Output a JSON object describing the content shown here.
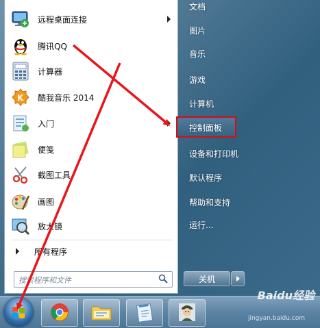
{
  "left_programs": [
    {
      "label": "远程桌面连接",
      "icon": "remote-desktop-icon",
      "submenu": true
    },
    {
      "label": "腾讯QQ",
      "icon": "qq-penguin-icon",
      "submenu": false
    },
    {
      "label": "计算器",
      "icon": "calculator-icon",
      "submenu": false
    },
    {
      "label": "酷我音乐 2014",
      "icon": "kuwo-music-icon",
      "submenu": false
    },
    {
      "label": "入门",
      "icon": "getting-started-icon",
      "submenu": true
    },
    {
      "label": "便笺",
      "icon": "sticky-notes-icon",
      "submenu": false
    },
    {
      "label": "截图工具",
      "icon": "snipping-tool-icon",
      "submenu": false
    },
    {
      "label": "画图",
      "icon": "paint-icon",
      "submenu": false
    },
    {
      "label": "放大镜",
      "icon": "magnifier-icon",
      "submenu": false
    }
  ],
  "all_programs": "所有程序",
  "search": {
    "placeholder": "搜索程序和文件"
  },
  "right_links": [
    "文档",
    "图片",
    "音乐",
    "游戏",
    "计算机",
    "控制面板",
    "设备和打印机",
    "默认程序",
    "帮助和支持",
    "运行..."
  ],
  "highlighted": "控制面板",
  "shutdown": {
    "label": "关机"
  },
  "taskbar": {
    "start_icon": "windows-orb-icon",
    "apps": [
      "chrome-icon",
      "file-explorer-icon",
      "notepad-icon",
      "character-avatar-icon"
    ]
  },
  "watermark": {
    "brand": "Baidu经验",
    "url": "jingyan.baidu.com"
  },
  "colors": {
    "highlight_border": "#d80d12",
    "arrow": "#e8151b"
  }
}
